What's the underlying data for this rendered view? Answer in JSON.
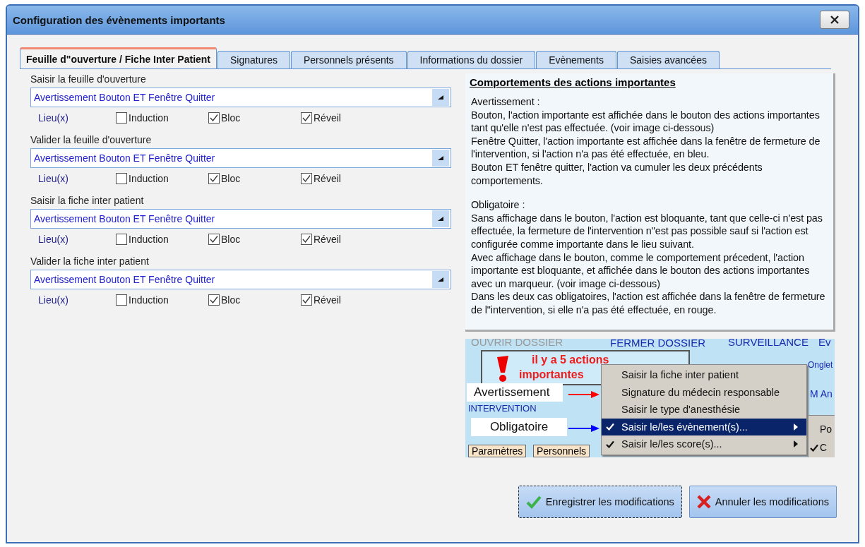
{
  "window": {
    "title": "Configuration des évènements importants"
  },
  "tabs": [
    {
      "label": "Feuille d\"ouverture / Fiche Inter Patient",
      "selected": true
    },
    {
      "label": "Signatures",
      "selected": false
    },
    {
      "label": "Personnels présents",
      "selected": false
    },
    {
      "label": "Informations du dossier",
      "selected": false
    },
    {
      "label": "Evènements",
      "selected": false
    },
    {
      "label": "Saisies avancées",
      "selected": false
    }
  ],
  "actions": [
    {
      "label": "Saisir la feuille d'ouverture",
      "value": "Avertissement Bouton ET Fenêtre Quitter",
      "places_label": "Lieu(x)",
      "places": [
        {
          "label": "Induction",
          "checked": false
        },
        {
          "label": "Bloc",
          "checked": true
        },
        {
          "label": "Réveil",
          "checked": true
        }
      ]
    },
    {
      "label": "Valider la feuille d'ouverture",
      "value": "Avertissement Bouton ET Fenêtre Quitter",
      "places_label": "Lieu(x)",
      "places": [
        {
          "label": "Induction",
          "checked": false
        },
        {
          "label": "Bloc",
          "checked": true
        },
        {
          "label": "Réveil",
          "checked": true
        }
      ]
    },
    {
      "label": "Saisir la fiche inter patient",
      "value": "Avertissement Bouton ET Fenêtre Quitter",
      "places_label": "Lieu(x)",
      "places": [
        {
          "label": "Induction",
          "checked": false
        },
        {
          "label": "Bloc",
          "checked": true
        },
        {
          "label": "Réveil",
          "checked": true
        }
      ]
    },
    {
      "label": "Valider la fiche inter patient",
      "value": "Avertissement Bouton ET Fenêtre Quitter",
      "places_label": "Lieu(x)",
      "places": [
        {
          "label": "Induction",
          "checked": false
        },
        {
          "label": "Bloc",
          "checked": true
        },
        {
          "label": "Réveil",
          "checked": true
        }
      ]
    }
  ],
  "help": {
    "title": "Comportements des actions importantes",
    "sections": [
      [
        "Avertissement :",
        "Bouton, l'action importante est affichée dans le bouton des actions importantes tant qu'elle n'est pas effectuée. (voir image ci-dessous)",
        "Fenêtre Quitter, l'action importante est affichée dans la fenêtre de fermeture de l'intervention, si l'action n'a pas été effectuée, en bleu.",
        "Bouton ET fenêtre quitter, l'action va cumuler les deux précédents comportements."
      ],
      [
        "Obligatoire :",
        "Sans affichage dans le bouton, l'action est bloquante, tant que celle-ci n'est pas effectuée, la fermeture de l'intervention n\"est pas possible sauf si l'action est configurée comme importante dans le lieu suivant.",
        "Avec affichage dans le bouton, comme le comportement précedent, l'action importante est bloquante, et affichée dans le bouton des actions importantes avec un marqueur. (voir image ci-dessous)",
        "Dans les deux cas obligatoires, l'action est affichée dans la fenêtre de fermeture de l\"intervention, si elle n'a pas été effectuée, en rouge."
      ]
    ]
  },
  "example_image": {
    "top_labels": [
      "OUVRIR DOSSIER",
      "FERMER DOSSIER",
      "SURVEILLANCE",
      "Ev"
    ],
    "alert_button": [
      "il y a 5 actions",
      "importantes"
    ],
    "side_labels": [
      "INTERVENTION",
      "Onglet",
      "M An"
    ],
    "bottom_tabs": [
      "Paramètres",
      "Personnels"
    ],
    "callouts": [
      {
        "label": "Avertissement",
        "color": "#ff0000"
      },
      {
        "label": "Obligatoire",
        "color": "#0000ff"
      }
    ],
    "menu": [
      {
        "label": "Saisir la fiche inter patient",
        "checked": false,
        "selected": false,
        "submenu": false
      },
      {
        "label": "Signature du médecin responsable",
        "checked": false,
        "selected": false,
        "submenu": false
      },
      {
        "label": "Saisir le type d'anesthésie",
        "checked": false,
        "selected": false,
        "submenu": false
      },
      {
        "label": "Saisir le/les évènement(s)...",
        "checked": true,
        "selected": true,
        "submenu": true
      },
      {
        "label": "Saisir le/les score(s)...",
        "checked": true,
        "selected": false,
        "submenu": true
      }
    ],
    "submenu": [
      {
        "label": "Po",
        "checked": false
      },
      {
        "label": "C",
        "checked": true
      }
    ]
  },
  "buttons": [
    {
      "label": "Enregistrer les modifications",
      "kind": "save"
    },
    {
      "label": "Annuler les modifications",
      "kind": "cancel"
    }
  ]
}
